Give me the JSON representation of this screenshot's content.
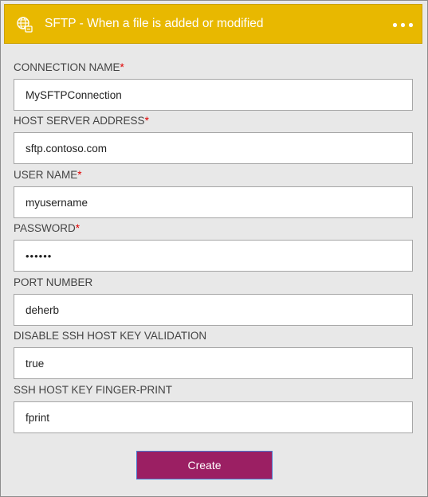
{
  "header": {
    "title": "SFTP - When a file is added or modified",
    "icon": "sftp-globe-icon",
    "menu_icon": "more-options-icon",
    "color": "#e8b800"
  },
  "fields": [
    {
      "label": "CONNECTION NAME",
      "required": true,
      "value": "MySFTPConnection"
    },
    {
      "label": "HOST SERVER ADDRESS",
      "required": true,
      "value": "sftp.contoso.com"
    },
    {
      "label": "USER NAME",
      "required": true,
      "value": "myusername"
    },
    {
      "label": "PASSWORD",
      "required": true,
      "value": "••••••"
    },
    {
      "label": "PORT NUMBER",
      "required": false,
      "value": "deherb"
    },
    {
      "label": "DISABLE SSH HOST KEY VALIDATION",
      "required": false,
      "value": "true"
    },
    {
      "label": "SSH HOST KEY FINGER-PRINT",
      "required": false,
      "value": "fprint"
    }
  ],
  "required_marker": "*",
  "create_button": {
    "label": "Create",
    "color": "#9b1f63"
  }
}
